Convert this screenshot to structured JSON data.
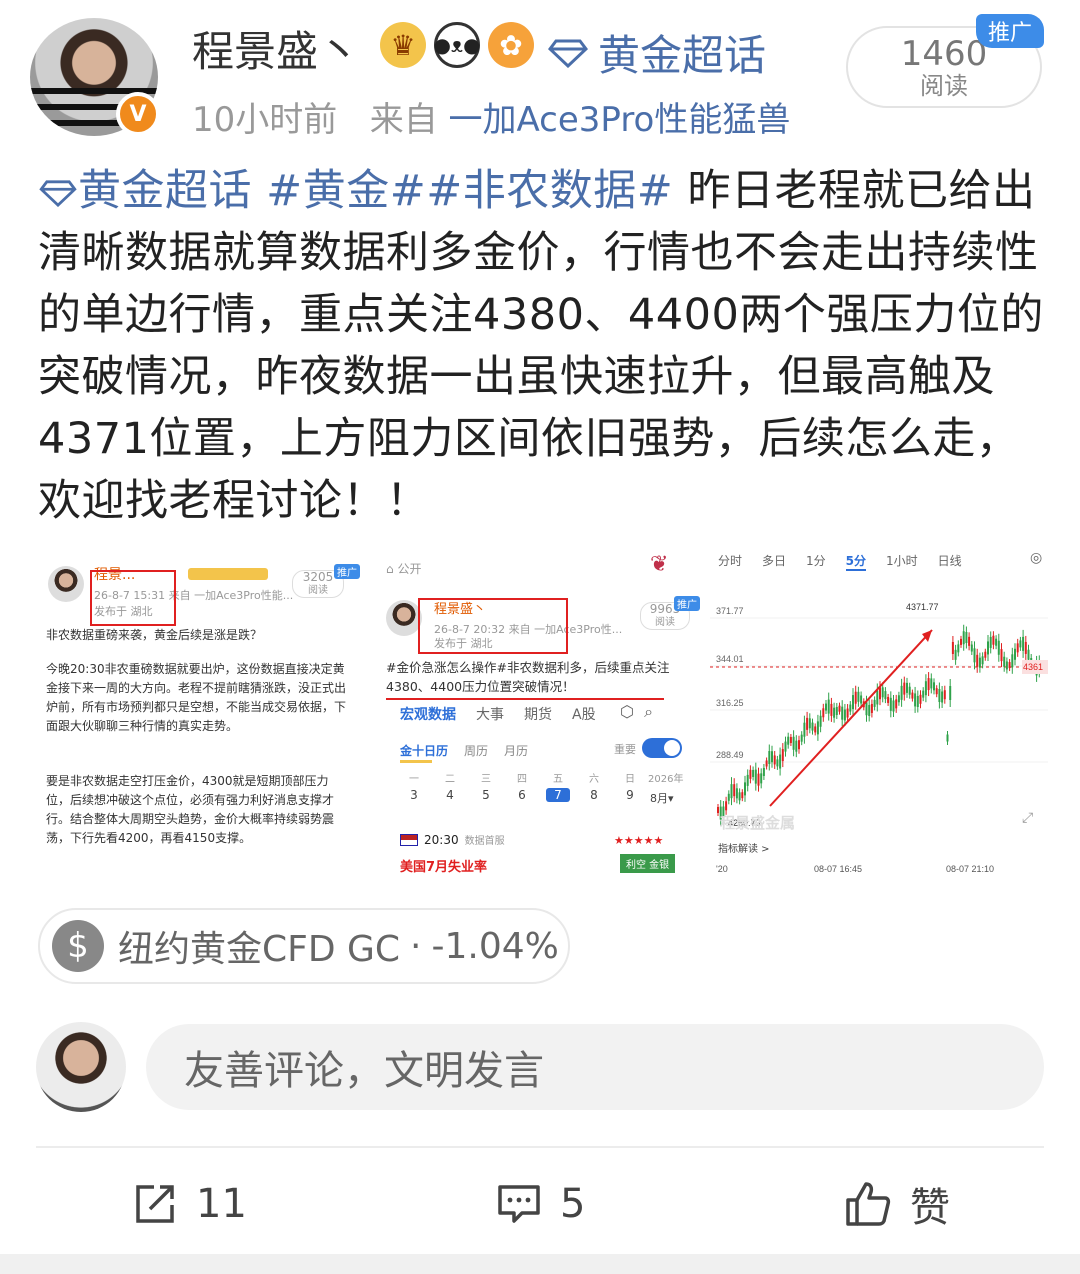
{
  "header": {
    "username": "程景盛丶",
    "supertopic": "黄金超话",
    "time": "10小时前",
    "from_label": "来自",
    "device": "一加Ace3Pro性能猛兽",
    "read_count": "1460",
    "read_label": "阅读",
    "promo": "推广",
    "avatar_badge": "V"
  },
  "post": {
    "topic": "黄金超话",
    "hashtag1": "#黄金#",
    "hashtag2": "#非农数据#",
    "body": " 昨日老程就已给出清晰数据就算数据利多金价，行情也不会走出持续性的单边行情，重点关注4380、4400两个强压力位的突破情况，昨夜数据一出虽快速拉升，但最高触及4371位置，上方阻力区间依旧强势，后续怎么走，欢迎找老程讨论！！"
  },
  "images": {
    "img1": {
      "name": "程景...",
      "promo": "推广",
      "reads": "3205",
      "reads_label": "阅读",
      "time": "26-8-7 15:31",
      "from": "来自 一加Ace3Pro性能...",
      "location": "发布于 湖北",
      "p1": "非农数据重磅来袭，黄金后续是涨是跌？",
      "p2": "今晚20:30非农重磅数据就要出炉，这份数据直接决定黄金接下来一周的大方向。老程不提前瞎猜涨跌，没正式出炉前，所有市场预判都只是空想，不能当成交易依据，下面跟大伙聊聊三种行情的真实走势。",
      "p3": "要是非农数据走空打压金价，4300就是短期顶部压力位，后续想冲破这个点位，必须有强力利好消息支撑才行。结合整体大周期空头趋势，金价大概率持续弱势震荡，下行先看4200，再看4150支撑。"
    },
    "img2": {
      "public": "公开",
      "name": "程景盛丶",
      "time": "26-8-7 20:32",
      "from": "来自 一加Ace3Pro性...",
      "location": "发布于 湖北",
      "reads": "9965",
      "reads_label": "阅读",
      "promo": "推广",
      "text": "#金价急涨怎么操作#非农数据利多，后续重点关注4380、4400压力位置突破情况！",
      "tabs": [
        "宏观数据",
        "大事",
        "期货",
        "A股"
      ],
      "subtabs": [
        "金十日历",
        "周历",
        "月历"
      ],
      "important": "重要",
      "weekdays": [
        "一",
        "二",
        "三",
        "四",
        "五",
        "六",
        "日"
      ],
      "dates": [
        "3",
        "4",
        "5",
        "6",
        "7",
        "8",
        "9"
      ],
      "year": "2026年",
      "month": "8月▾",
      "event_time": "20:30",
      "event_tag": "数据首服",
      "event_name": "美国7月失业率",
      "event_result": "利空 金银",
      "stars": "★★★★★"
    },
    "img3": {
      "tabs": [
        "分时",
        "多日",
        "1分",
        "5分",
        "1小时",
        "日线"
      ],
      "active_tab": "5分",
      "high_label": "4371.77",
      "low_label": "4260.73",
      "right_label": "4361",
      "indicator": "指标解读 >",
      "x_ticks": [
        "'20",
        "08-07 16:45",
        "08-07 21:10"
      ],
      "watermark": "程景盛金属"
    }
  },
  "chart_data": {
    "type": "line",
    "title": "",
    "y_ticks": [
      "371.77",
      "344.01",
      "316.25",
      "288.49"
    ],
    "x_ticks": [
      "'20",
      "08-07 16:45",
      "08-07 21:10"
    ],
    "annotations": [
      "4371.77",
      "4260.73",
      "4361"
    ],
    "active_interval": "5分"
  },
  "tag": {
    "label": "纽约黄金CFD GC",
    "sep": "·",
    "change": "-1.04%",
    "icon": "$"
  },
  "comment": {
    "placeholder": "友善评论，文明发言"
  },
  "actions": {
    "share_count": "11",
    "comment_count": "5",
    "like_label": "赞"
  },
  "colors": {
    "link": "#4a6ea9",
    "promo": "#3d8ce8",
    "verified": "#f08a1c",
    "down": "#e02020"
  }
}
